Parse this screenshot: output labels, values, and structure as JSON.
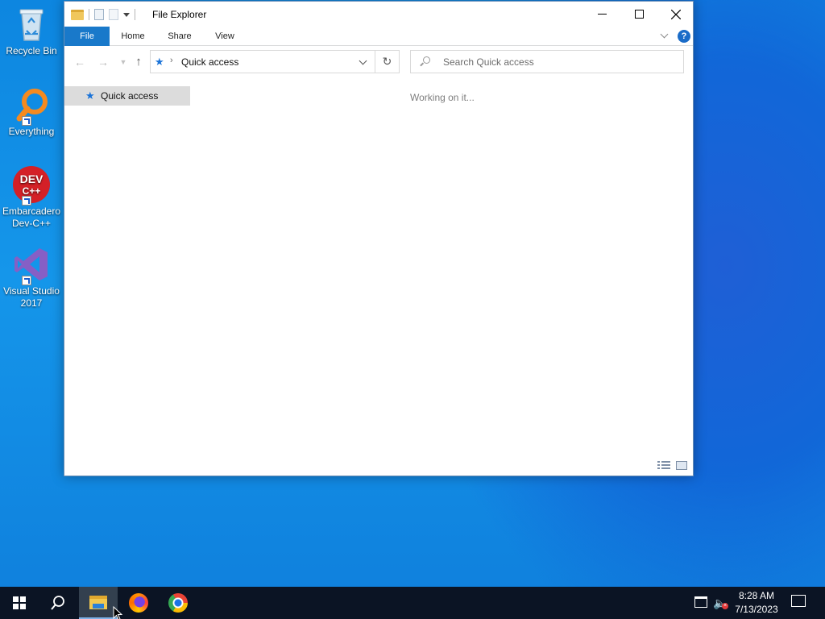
{
  "desktop": {
    "icons": [
      {
        "label": "Recycle Bin",
        "icon": "recycle-bin-icon"
      },
      {
        "label": "Everything",
        "icon": "everything-search-icon"
      },
      {
        "label": "Embarcadero Dev-C++",
        "icon": "dev-cpp-icon",
        "logo_text": "DEV C++"
      },
      {
        "label": "Visual Studio 2017",
        "icon": "visual-studio-icon"
      }
    ]
  },
  "explorer": {
    "title": "File Explorer",
    "ribbon_tabs": {
      "file": "File",
      "home": "Home",
      "share": "Share",
      "view": "View"
    },
    "help_glyph": "?",
    "address": {
      "location": "Quick access"
    },
    "search": {
      "placeholder": "Search Quick access"
    },
    "navpane": {
      "quick_access": "Quick access"
    },
    "status": "Working on it..."
  },
  "taskbar": {
    "apps": [
      "start",
      "search",
      "file-explorer",
      "firefox",
      "chrome"
    ],
    "active": "file-explorer",
    "clock": {
      "time": "8:28 AM",
      "date": "7/13/2023"
    }
  },
  "colors": {
    "accent": "#1979ca",
    "desktop": "#0f86e2",
    "taskbar": "#0b1424"
  }
}
